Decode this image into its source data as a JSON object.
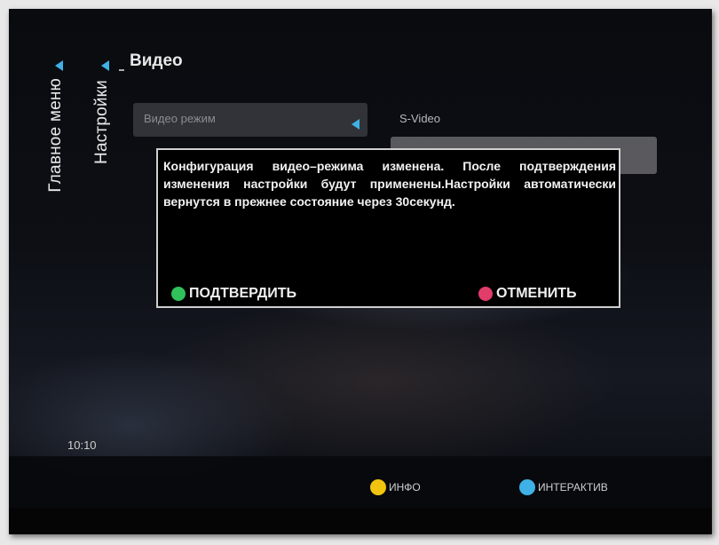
{
  "breadcrumb": {
    "main_menu": "Главное меню",
    "settings": "Настройки"
  },
  "page": {
    "title": "Видео"
  },
  "video_mode": {
    "label": "Видео режим",
    "value": "S-Video"
  },
  "dialog": {
    "message": "Конфигурация видео–режима изменена. После подтверждения изменения настройки будут применены.Настройки автоматически вернутся в прежнее состояние через 30секунд.",
    "confirm_label": "ПОДТВЕРДИТЬ",
    "cancel_label": "ОТМЕНИТЬ"
  },
  "status": {
    "time": "10:10"
  },
  "hints": {
    "info_label": "ИНФО",
    "interactive_label": "ИНТЕРАКТИВ"
  },
  "colors": {
    "accent_arrow": "#3fb1e6",
    "confirm_green": "#31c15a",
    "cancel_red": "#e23c6a",
    "info_yellow": "#f1c40f",
    "interactive_blue": "#3fb1e6"
  },
  "icons": {
    "breadcrumb_arrow": "triangle-left-icon",
    "mode_arrow": "triangle-left-icon",
    "confirm": "green-circle-icon",
    "cancel": "red-circle-icon",
    "info": "yellow-circle-icon",
    "interactive": "blue-circle-icon"
  }
}
